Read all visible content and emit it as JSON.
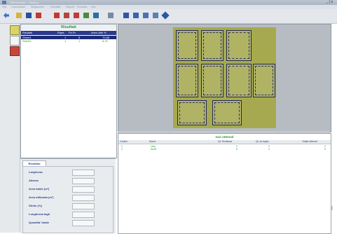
{
  "window": {
    "title": "Ottimizzatore - Nesting",
    "controls": "_ | x"
  },
  "menu": [
    "File",
    "Commesse",
    "Magazzino",
    "Risultati",
    "Report",
    "Finestra",
    "Info"
  ],
  "results": {
    "title": "Risultati",
    "columns": [
      "Risultati",
      "Ripet.",
      "Pz.Pr.",
      "Area utile %"
    ],
    "rows": [
      {
        "name": "Sheet1",
        "rep": "1",
        "pz": "8",
        "area": "70,88",
        "selected": true
      },
      {
        "name": "Sheet1",
        "rep": "1",
        "pz": "1",
        "area": "8,75",
        "selected": false
      }
    ]
  },
  "properties": {
    "tab_label": "Risultato",
    "fields": [
      {
        "label": "Larghezza",
        "value": ""
      },
      {
        "label": "Altezza",
        "value": ""
      },
      {
        "label": "Area totale (m²)",
        "value": ""
      },
      {
        "label": "Area utilizzata (m²)",
        "value": ""
      },
      {
        "label": "Sfrido (%)",
        "value": ""
      },
      {
        "label": "Lunghezza tagli",
        "value": ""
      },
      {
        "label": "Quantita' totale",
        "value": ""
      }
    ]
  },
  "pieces_list": {
    "title": "ezzi ottenuti",
    "columns": [
      "Codice",
      "Nome",
      "Qt. Richiesta",
      "Qt. su foglio",
      "Totale ottenuti"
    ],
    "rows": [
      {
        "code": "1",
        "name": "Lato",
        "req": "2",
        "sheet": "2",
        "total": "2"
      },
      {
        "code": "2",
        "name": "Sezff",
        "req": "5",
        "sheet": "4",
        "total": "5"
      }
    ]
  },
  "colors": {
    "accent_green": "#1f9a2a",
    "header_blue": "#2a3a8c",
    "sheet_olive": "#a6a94f"
  }
}
